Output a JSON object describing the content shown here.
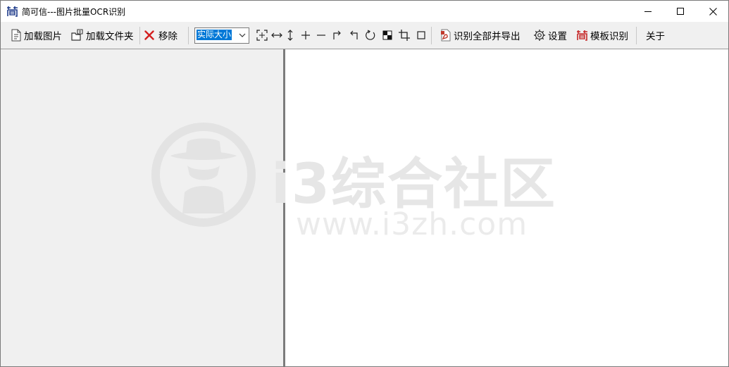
{
  "window": {
    "title": "简可信---图片批量OCR识别",
    "app_icon": "jian-logo-icon",
    "controls": [
      "minimize-icon",
      "maximize-icon",
      "close-icon"
    ]
  },
  "toolbar": {
    "load_image": "加载图片",
    "load_folder": "加载文件夹",
    "remove": "移除",
    "zoom_value": "实际大小",
    "view_tools": [
      "fit-window-icon",
      "fit-width-icon",
      "fit-height-icon",
      "zoom-in-icon",
      "zoom-out-icon",
      "rotate-right-icon",
      "rotate-left-icon",
      "rotate-icon",
      "contrast-icon",
      "crop-icon",
      "select-rect-icon"
    ],
    "recognize_export": "识别全部并导出",
    "settings": "设置",
    "template_recognize": "模板识别",
    "about": "关于"
  },
  "watermark": {
    "name": "i3综合社区",
    "url": "www.i3zh.com"
  },
  "colors": {
    "accent": "#0078d7",
    "remove_red": "#d32020",
    "pdf_red": "#c0392b",
    "logo_blue": "#1f3b8a",
    "pane_gray": "#f0f0f0",
    "splitter": "#7c7c7c"
  }
}
